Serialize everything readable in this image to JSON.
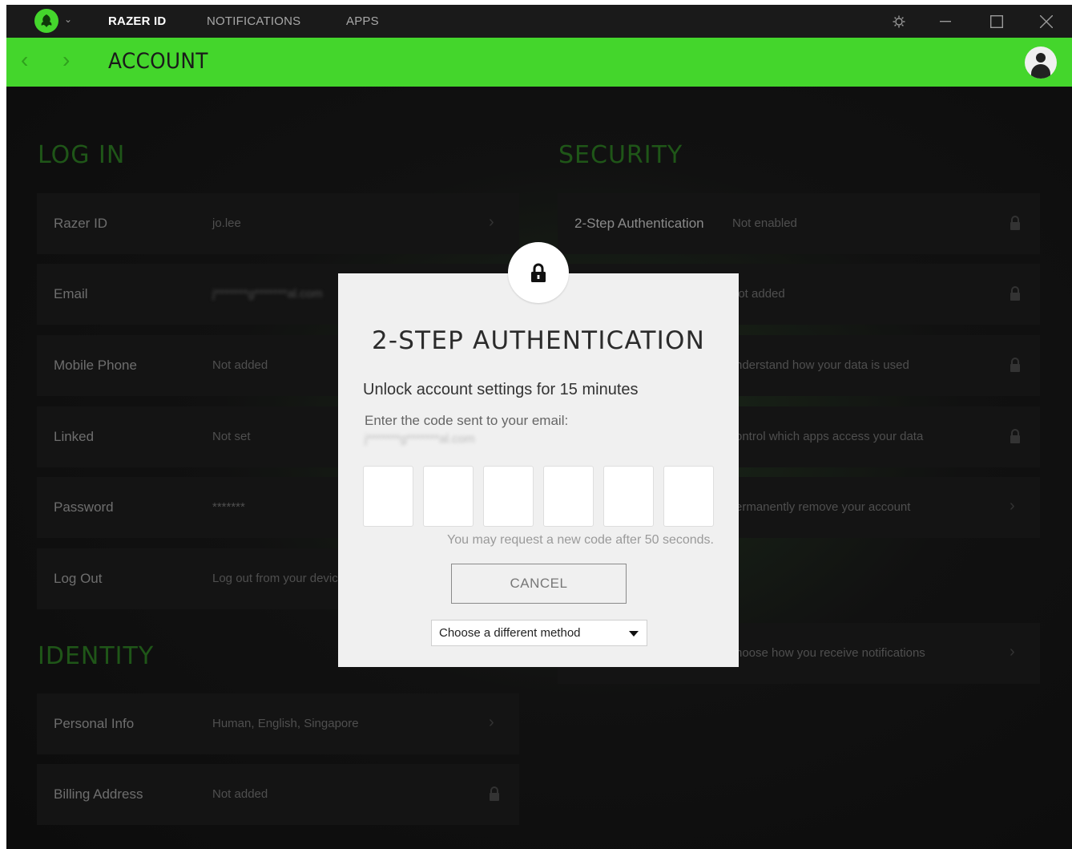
{
  "colors": {
    "accent": "#44d62c",
    "titlebar": "#1a1a1a",
    "modal_bg": "#f0f0f0"
  },
  "titlebar": {
    "nav": [
      "RAZER ID",
      "NOTIFICATIONS",
      "APPS"
    ],
    "active_tab": "RAZER ID"
  },
  "header": {
    "title": "ACCOUNT"
  },
  "login": {
    "title": "LOG IN",
    "rows": [
      {
        "label": "Razer ID",
        "value": "jo.lee",
        "icon": "chevron-right-icon"
      },
      {
        "label": "Email",
        "value": "j*******g*******al.com",
        "icon": "chevron-right-icon"
      },
      {
        "label": "Mobile Phone",
        "value": "Not added",
        "icon": "chevron-right-icon"
      },
      {
        "label": "Linked",
        "value": "Not set",
        "icon": "chevron-right-icon"
      },
      {
        "label": "Password",
        "value": "*******",
        "icon": "chevron-right-icon"
      },
      {
        "label": "Log Out",
        "value": "Log out from your devic",
        "icon": "chevron-right-icon"
      }
    ]
  },
  "identity": {
    "title": "IDENTITY",
    "rows": [
      {
        "label": "Personal Info",
        "value": "Human, English, Singapore",
        "icon": "chevron-right-icon"
      },
      {
        "label": "Billing Address",
        "value": "Not added",
        "icon": "lock-icon"
      }
    ]
  },
  "security": {
    "title": "SECURITY",
    "rows": [
      {
        "label": "2-Step Authentication",
        "value": "Not enabled",
        "icon": "lock-icon"
      },
      {
        "label": "",
        "value": "lot added",
        "icon": "lock-icon"
      },
      {
        "label": "",
        "value": "nderstand how your data is used",
        "icon": "lock-icon"
      },
      {
        "label": "",
        "value": "ontrol which apps access your data",
        "icon": "lock-icon"
      },
      {
        "label": "",
        "value": "ermanently remove your account",
        "icon": "chevron-right-icon"
      },
      {
        "label": "",
        "value": "hoose how you receive notifications",
        "icon": "chevron-right-icon"
      }
    ]
  },
  "modal": {
    "title": "2-STEP AUTHENTICATION",
    "subtitle": "Unlock account settings for 15 minutes",
    "prompt": "Enter the code sent to your email:",
    "masked_email": "j*******g*******al.com",
    "code_digits": [
      "",
      "",
      "",
      "",
      "",
      ""
    ],
    "resend_note": "You may request a new code after 50 seconds.",
    "cancel_label": "CANCEL",
    "method_select": "Choose a different method"
  }
}
